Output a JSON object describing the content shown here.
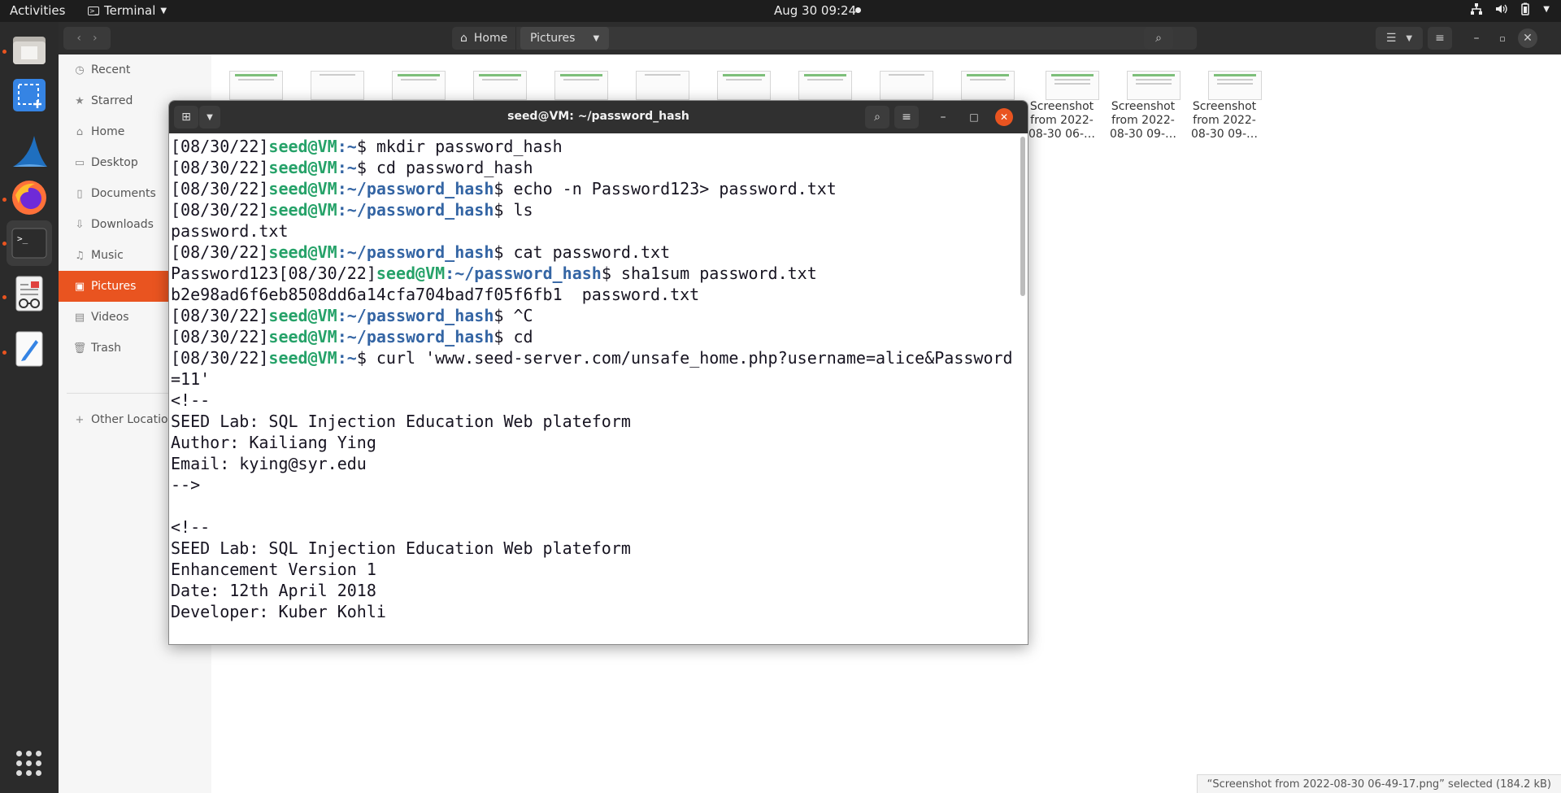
{
  "topbar": {
    "activities": "Activities",
    "app_name": "Terminal",
    "clock": "Aug 30  09:24",
    "tray_icons": [
      "network-icon",
      "volume-icon",
      "battery-icon",
      "power-menu-icon"
    ]
  },
  "dock": {
    "items": [
      "files-icon",
      "screenshot-tool-icon",
      "wireshark-icon",
      "firefox-icon",
      "terminal-icon",
      "document-viewer-icon",
      "text-editor-icon"
    ],
    "show_apps": "show-applications-icon"
  },
  "file_manager": {
    "path": [
      "Home",
      "Pictures"
    ],
    "sidebar": [
      {
        "label": "Recent",
        "icon": "clock-icon"
      },
      {
        "label": "Starred",
        "icon": "star-icon"
      },
      {
        "label": "Home",
        "icon": "home-icon"
      },
      {
        "label": "Desktop",
        "icon": "desktop-icon"
      },
      {
        "label": "Documents",
        "icon": "documents-icon"
      },
      {
        "label": "Downloads",
        "icon": "download-icon"
      },
      {
        "label": "Music",
        "icon": "music-icon"
      },
      {
        "label": "Pictures",
        "icon": "pictures-icon"
      },
      {
        "label": "Videos",
        "icon": "videos-icon"
      },
      {
        "label": "Trash",
        "icon": "trash-icon"
      },
      {
        "label": "Other Locations",
        "icon": "plus-icon"
      }
    ],
    "visible_files": [
      {
        "line1": "Screenshot",
        "line2": "from 2022-",
        "line3": "08-30 06-…"
      },
      {
        "line1": "Screenshot",
        "line2": "from 2022-",
        "line3": "08-30 09-…"
      },
      {
        "line1": "Screenshot",
        "line2": "from 2022-",
        "line3": "08-30 09-…"
      }
    ],
    "status": "“Screenshot from 2022-08-30 06-49-17.png” selected  (184.2 kB)"
  },
  "terminal": {
    "title": "seed@VM: ~/password_hash",
    "lines": [
      {
        "pre": "",
        "date": "[08/30/22]",
        "user": "seed@VM",
        "path": ":~",
        "cmd": "$ mkdir password_hash"
      },
      {
        "pre": "",
        "date": "[08/30/22]",
        "user": "seed@VM",
        "path": ":~",
        "cmd": "$ cd password_hash"
      },
      {
        "pre": "",
        "date": "[08/30/22]",
        "user": "seed@VM",
        "path": ":~/password_hash",
        "cmd": "$ echo -n Password123> password.txt"
      },
      {
        "pre": "",
        "date": "[08/30/22]",
        "user": "seed@VM",
        "path": ":~/password_hash",
        "cmd": "$ ls"
      },
      {
        "text": "password.txt"
      },
      {
        "pre": "",
        "date": "[08/30/22]",
        "user": "seed@VM",
        "path": ":~/password_hash",
        "cmd": "$ cat password.txt"
      },
      {
        "pre": "Password123",
        "date": "[08/30/22]",
        "user": "seed@VM",
        "path": ":~/password_hash",
        "cmd": "$ sha1sum password.txt"
      },
      {
        "text": "b2e98ad6f6eb8508dd6a14cfa704bad7f05f6fb1  password.txt"
      },
      {
        "pre": "",
        "date": "[08/30/22]",
        "user": "seed@VM",
        "path": ":~/password_hash",
        "cmd": "$ ^C"
      },
      {
        "pre": "",
        "date": "[08/30/22]",
        "user": "seed@VM",
        "path": ":~/password_hash",
        "cmd": "$ cd"
      },
      {
        "pre": "",
        "date": "[08/30/22]",
        "user": "seed@VM",
        "path": ":~",
        "cmd": "$ curl 'www.seed-server.com/unsafe_home.php?username=alice&Password=11'"
      },
      {
        "text": "<!--"
      },
      {
        "text": "SEED Lab: SQL Injection Education Web plateform"
      },
      {
        "text": "Author: Kailiang Ying"
      },
      {
        "text": "Email: kying@syr.edu"
      },
      {
        "text": "-->"
      },
      {
        "text": ""
      },
      {
        "text": "<!--"
      },
      {
        "text": "SEED Lab: SQL Injection Education Web plateform"
      },
      {
        "text": "Enhancement Version 1"
      },
      {
        "text": "Date: 12th April 2018"
      },
      {
        "text": "Developer: Kuber Kohli"
      }
    ]
  }
}
